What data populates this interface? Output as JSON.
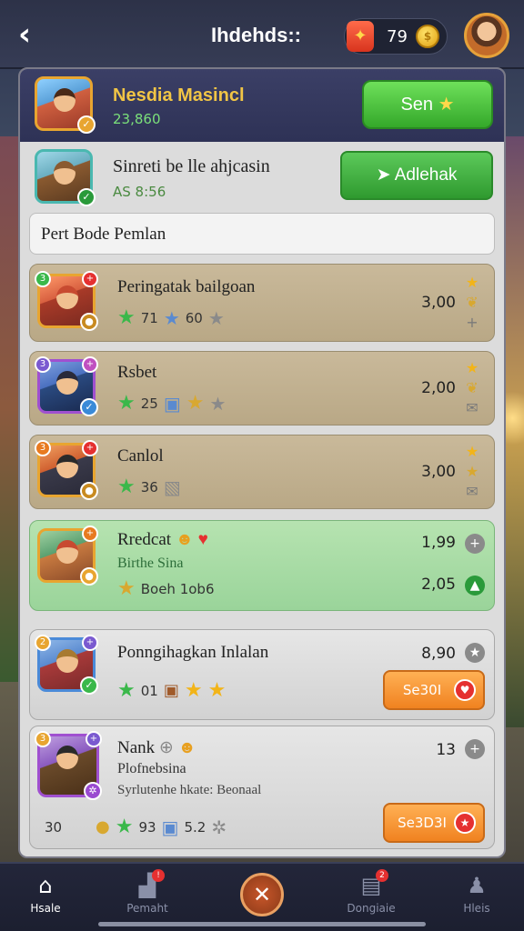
{
  "header": {
    "title": "Ihdehds::",
    "coin_count": "79",
    "back_icon": "chevron-left-icon"
  },
  "banner": {
    "name": "Nesdia Masincl",
    "score": "23,860",
    "send_label": "Sen"
  },
  "invite": {
    "name": "Sinreti be lle ahjcasin",
    "code": "AS 8:56",
    "accept_label": "Adlehak"
  },
  "section": {
    "label": "Pert Bode Pemlan"
  },
  "cards": [
    {
      "title": "Peringatak bailgoan",
      "stat1": "71",
      "stat2": "60",
      "score": "3,00"
    },
    {
      "title": "Rsbet",
      "stat1": "25",
      "score": "2,00"
    },
    {
      "title": "Canlol",
      "stat1": "36",
      "score": "3,00"
    },
    {
      "title": "Rredcat",
      "sub": "Birthe Sina",
      "stat_label": "Boeh 1ob6",
      "score_top": "1,99",
      "score_bottom": "2,05"
    },
    {
      "title": "Ponngihagkan Inlalan",
      "stat1": "01",
      "score": "8,90",
      "button": "Se30I"
    },
    {
      "title": "Nank",
      "sub": "Plofnebsina",
      "sub2": "Syrlutenhe hkate: Beonaal",
      "left_num": "30",
      "stat1": "93",
      "stat2": "5.2",
      "score": "13",
      "button": "Se3D3I"
    }
  ],
  "nav": {
    "items": [
      {
        "label": "Hsale"
      },
      {
        "label": "Pemaht"
      },
      {
        "label": "Dongiaie"
      },
      {
        "label": "Hleis"
      }
    ]
  }
}
